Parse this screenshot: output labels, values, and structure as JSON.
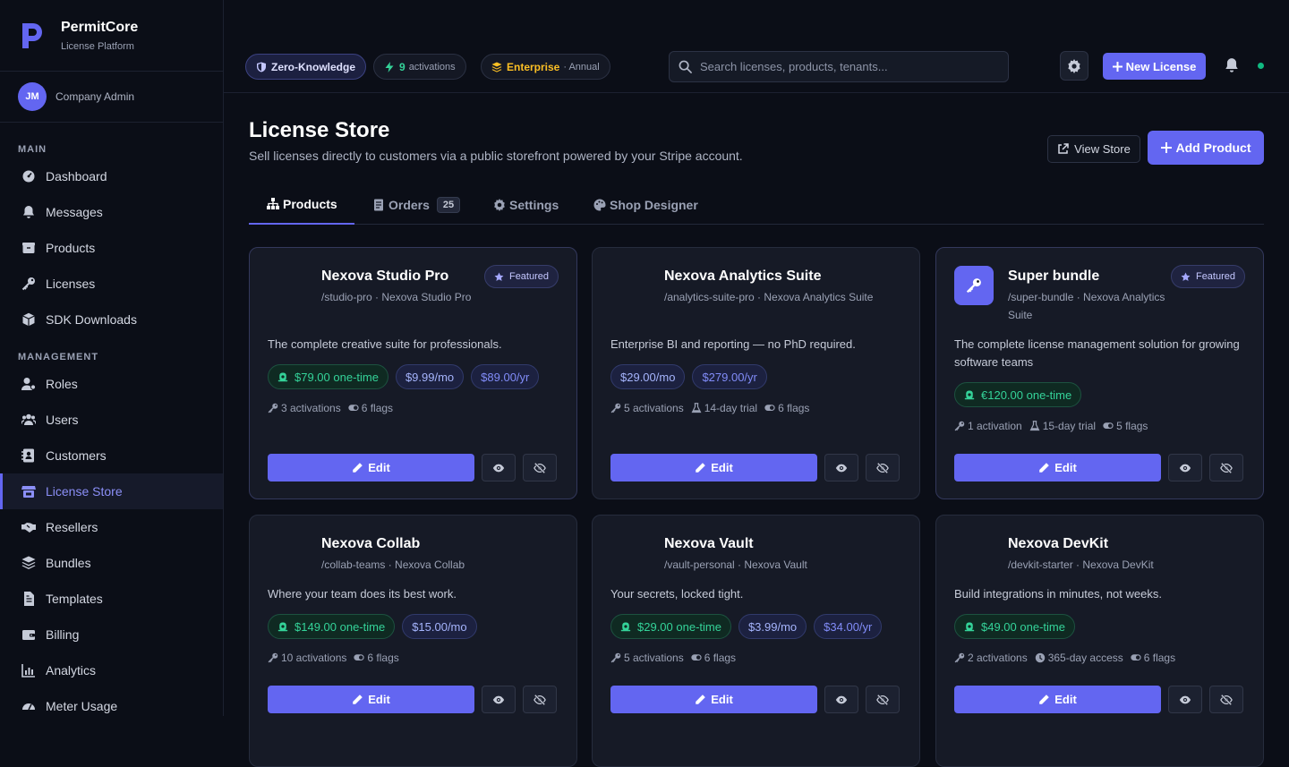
{
  "brand": {
    "name": "PermitCore",
    "subtitle": "License Platform"
  },
  "user": {
    "initials": "JM",
    "role": "Company Admin"
  },
  "sidebar": {
    "sections": [
      {
        "label": "MAIN",
        "items": [
          {
            "label": "Dashboard",
            "icon": "dashboard-icon"
          },
          {
            "label": "Messages",
            "icon": "bell-icon"
          },
          {
            "label": "Products",
            "icon": "box-icon"
          },
          {
            "label": "Licenses",
            "icon": "key-icon"
          },
          {
            "label": "SDK Downloads",
            "icon": "cube-icon"
          }
        ]
      },
      {
        "label": "MANAGEMENT",
        "items": [
          {
            "label": "Roles",
            "icon": "user-gear-icon"
          },
          {
            "label": "Users",
            "icon": "users-icon"
          },
          {
            "label": "Customers",
            "icon": "contact-book-icon"
          },
          {
            "label": "License Store",
            "icon": "store-icon",
            "active": true
          },
          {
            "label": "Resellers",
            "icon": "handshake-icon"
          },
          {
            "label": "Bundles",
            "icon": "layers-icon"
          },
          {
            "label": "Templates",
            "icon": "file-icon"
          },
          {
            "label": "Billing",
            "icon": "wallet-icon"
          },
          {
            "label": "Analytics",
            "icon": "chart-icon"
          },
          {
            "label": "Meter Usage",
            "icon": "meter-icon"
          }
        ]
      }
    ]
  },
  "topbar": {
    "badges": [
      {
        "label": "Zero-Knowledge",
        "icon": "shield-icon"
      },
      {
        "label": "9",
        "suffix": "activations",
        "icon": "bolt-icon"
      },
      {
        "label": "Enterprise",
        "suffix": "· Annual",
        "icon": "stack-icon"
      }
    ],
    "search_placeholder": "Search licenses, products, tenants...",
    "new_button": "New License"
  },
  "page": {
    "title": "License Store",
    "subtitle": "Sell licenses directly to customers via a public storefront powered by your Stripe account.",
    "view_store": "View Store",
    "add_product": "Add Product"
  },
  "tabs": [
    {
      "label": "Products",
      "icon": "sitemap-icon",
      "active": true
    },
    {
      "label": "Orders",
      "icon": "receipt-icon",
      "count": "25"
    },
    {
      "label": "Settings",
      "icon": "gear-icon"
    },
    {
      "label": "Shop Designer",
      "icon": "palette-icon"
    }
  ],
  "products": [
    {
      "name": "Nexova Studio Pro",
      "slug": "/studio-pro · Nexova Studio Pro",
      "featured": true,
      "featured_label": "Featured",
      "logo": false,
      "description": "The complete creative suite for professionals.",
      "prices": [
        {
          "label": "$79.00 one-time",
          "type": "onetime"
        },
        {
          "label": "$9.99/mo",
          "type": "mo"
        },
        {
          "label": "$89.00/yr",
          "type": "yr"
        }
      ],
      "meta": [
        {
          "icon": "key-icon",
          "label": "3 activations"
        },
        {
          "icon": "toggle-icon",
          "label": "6 flags"
        }
      ],
      "edit": "Edit"
    },
    {
      "name": "Nexova Analytics Suite",
      "slug": "/analytics-suite-pro · Nexova Analytics Suite",
      "featured": false,
      "logo": false,
      "description": "Enterprise BI and reporting — no PhD required.",
      "prices": [
        {
          "label": "$29.00/mo",
          "type": "mo"
        },
        {
          "label": "$279.00/yr",
          "type": "yr"
        }
      ],
      "meta": [
        {
          "icon": "key-icon",
          "label": "5 activations"
        },
        {
          "icon": "flask-icon",
          "label": "14-day trial"
        },
        {
          "icon": "toggle-icon",
          "label": "6 flags"
        }
      ],
      "edit": "Edit"
    },
    {
      "name": "Super bundle",
      "slug": "/super-bundle · Nexova Analytics Suite",
      "featured": true,
      "featured_label": "Featured",
      "logo": true,
      "description": "The complete license management solution for growing software teams",
      "prices": [
        {
          "label": "€120.00 one-time",
          "type": "onetime"
        }
      ],
      "meta": [
        {
          "icon": "key-icon",
          "label": "1 activation"
        },
        {
          "icon": "flask-icon",
          "label": "15-day trial"
        },
        {
          "icon": "toggle-icon",
          "label": "5 flags"
        }
      ],
      "edit": "Edit"
    },
    {
      "name": "Nexova Collab",
      "slug": "/collab-teams · Nexova Collab",
      "featured": false,
      "logo": false,
      "description": "Where your team does its best work.",
      "prices": [
        {
          "label": "$149.00 one-time",
          "type": "onetime"
        },
        {
          "label": "$15.00/mo",
          "type": "mo"
        }
      ],
      "meta": [
        {
          "icon": "key-icon",
          "label": "10 activations"
        },
        {
          "icon": "toggle-icon",
          "label": "6 flags"
        }
      ],
      "edit": "Edit"
    },
    {
      "name": "Nexova Vault",
      "slug": "/vault-personal · Nexova Vault",
      "featured": false,
      "logo": false,
      "description": "Your secrets, locked tight.",
      "prices": [
        {
          "label": "$29.00 one-time",
          "type": "onetime"
        },
        {
          "label": "$3.99/mo",
          "type": "mo"
        },
        {
          "label": "$34.00/yr",
          "type": "yr"
        }
      ],
      "meta": [
        {
          "icon": "key-icon",
          "label": "5 activations"
        },
        {
          "icon": "toggle-icon",
          "label": "6 flags"
        }
      ],
      "edit": "Edit"
    },
    {
      "name": "Nexova DevKit",
      "slug": "/devkit-starter · Nexova DevKit",
      "featured": false,
      "logo": false,
      "description": "Build integrations in minutes, not weeks.",
      "prices": [
        {
          "label": "$49.00 one-time",
          "type": "onetime"
        }
      ],
      "meta": [
        {
          "icon": "key-icon",
          "label": "2 activations"
        },
        {
          "icon": "clock-icon",
          "label": "365-day access"
        },
        {
          "icon": "toggle-icon",
          "label": "6 flags"
        }
      ],
      "edit": "Edit"
    }
  ]
}
